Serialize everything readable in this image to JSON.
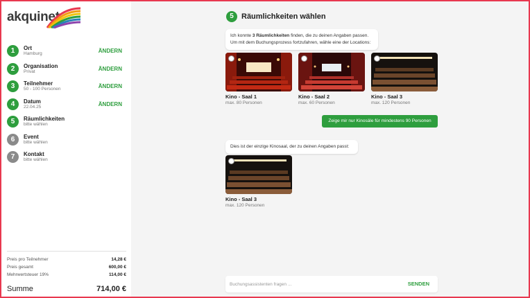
{
  "brand": {
    "name": "akquinet",
    "accent": "#2e9e3e"
  },
  "steps": [
    {
      "num": "1",
      "title": "Ort",
      "sub": "Hamburg",
      "edit": "ÄNDERN",
      "done": true
    },
    {
      "num": "2",
      "title": "Organisation",
      "sub": "Privat",
      "edit": "ÄNDERN",
      "done": true
    },
    {
      "num": "3",
      "title": "Teilnehmer",
      "sub": "50 - 100 Personen",
      "edit": "ÄNDERN",
      "done": true
    },
    {
      "num": "4",
      "title": "Datum",
      "sub": "22.04.25",
      "edit": "ÄNDERN",
      "done": true
    },
    {
      "num": "5",
      "title": "Räumlichkeiten",
      "sub": "bitte wählen",
      "done": true
    },
    {
      "num": "6",
      "title": "Event",
      "sub": "bitte wählen",
      "done": false
    },
    {
      "num": "7",
      "title": "Kontakt",
      "sub": "bitte wählen",
      "done": false
    }
  ],
  "prices": {
    "per_person_label": "Preis pro Teilnehmer",
    "per_person": "14,28 €",
    "total_label": "Preis gesamt",
    "total": "600,00 €",
    "tax_label": "Mehrwertsteuer 19%",
    "tax": "114,00 €",
    "sum_label": "Summe",
    "sum": "714,00 €"
  },
  "main": {
    "step_num": "5",
    "title": "Räumlichkeiten wählen",
    "intro_pre": "Ich konnte ",
    "intro_bold": "3 Räumlichkeiten",
    "intro_post": " finden, die zu deinen Angaben passen.",
    "intro_line2": "Um mit dem Buchungsprozess fortzufahren, wähle eine der Locations:",
    "cards": [
      {
        "title": "Kino - Saal 1",
        "sub": "max. 80 Personen"
      },
      {
        "title": "Kino - Saal 2",
        "sub": "max. 60 Personen"
      },
      {
        "title": "Kino - Saal 3",
        "sub": "max. 120 Personen"
      }
    ],
    "filter_button": "Zeige mir nur Kinosäle für mindestens 90 Personen",
    "filtered_message": "Dies ist der einzige Kinosaal, der zu deinen Angaben passt:",
    "filtered_card": {
      "title": "Kino - Saal 3",
      "sub": "max. 120 Personen"
    },
    "chat_placeholder": "Buchungsassistenten fragen ...",
    "send": "SENDEN"
  }
}
